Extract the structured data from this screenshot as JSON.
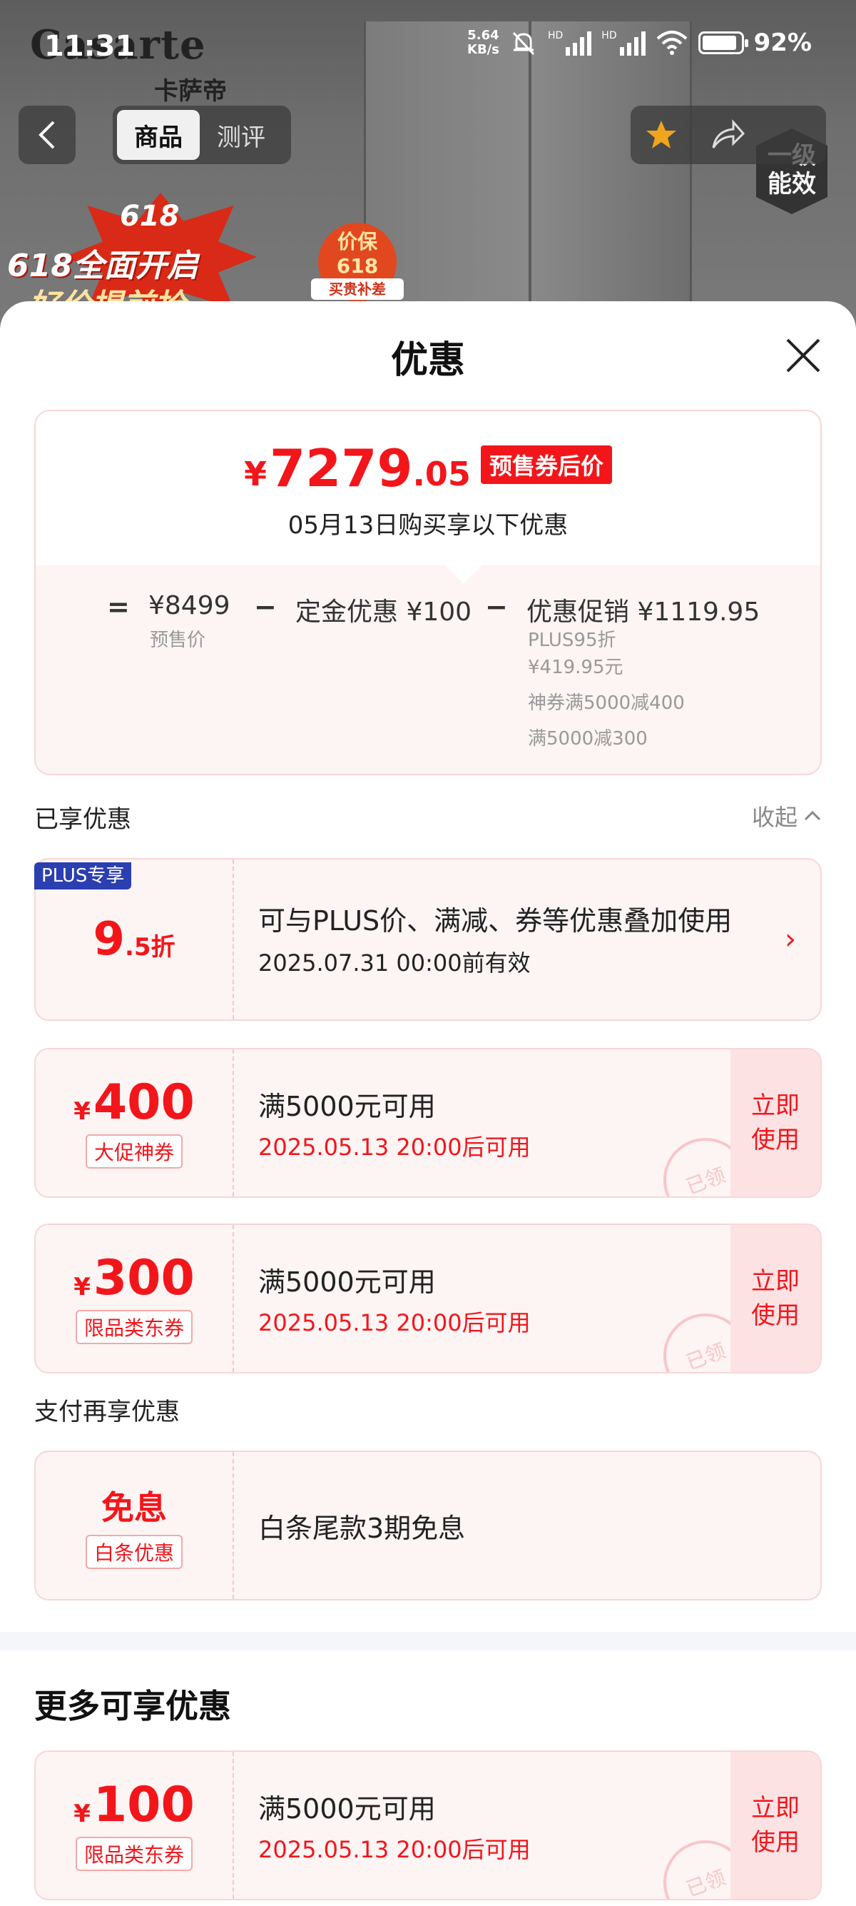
{
  "status_bar": {
    "time": "11:31",
    "speed_value": "5.64",
    "speed_unit": "KB/s",
    "hd1": "HD",
    "hd2": "HD",
    "battery": "92%"
  },
  "header": {
    "brand_en": "Casarte",
    "brand_cn": "卡萨帝",
    "tabs": [
      {
        "label": "商品",
        "active": true
      },
      {
        "label": "测评",
        "active": false
      }
    ],
    "energy_label": "一级能效",
    "promo_618": "618",
    "promo_line1": "618全面开启",
    "promo_line2": "好价提前抢",
    "price_protect": "价保618",
    "price_protect_sub": "买贵补差"
  },
  "sheet": {
    "title": "优惠",
    "summary": {
      "currency": "¥",
      "price_int": "7279",
      "price_dec": ".05",
      "price_tag": "预售券后价",
      "date_line": "05月13日购买享以下优惠",
      "eq": "=",
      "minus": "−",
      "presale_price": "¥8499",
      "presale_label": "预售价",
      "deposit_discount": "定金优惠 ¥100",
      "promo_discount": "优惠促销 ¥1119.95",
      "promo_details": [
        "PLUS95折",
        "¥419.95元",
        "神券满5000减400",
        "满5000减300"
      ]
    },
    "enjoyed": {
      "label": "已享优惠",
      "collapse_label": "收起"
    },
    "plus_card": {
      "badge": "PLUS专享",
      "disc_big": "9",
      "disc_small": ".5折",
      "text": "可与PLUS价、满减、券等优惠叠加使用",
      "valid": "2025.07.31 00:00前有效"
    },
    "coupons": [
      {
        "currency": "¥",
        "amount": "400",
        "tag": "大促神券",
        "condition": "满5000元可用",
        "time": "2025.05.13 20:00后可用",
        "use": "立即使用",
        "stamp": "已领"
      },
      {
        "currency": "¥",
        "amount": "300",
        "tag": "限品类东券",
        "condition": "满5000元可用",
        "time": "2025.05.13 20:00后可用",
        "use": "立即使用",
        "stamp": "已领"
      }
    ],
    "pay": {
      "label": "支付再享优惠",
      "title": "免息",
      "tag": "白条优惠",
      "text": "白条尾款3期免息"
    },
    "more": {
      "title": "更多可享优惠",
      "coupon": {
        "currency": "¥",
        "amount": "100",
        "tag": "限品类东券",
        "condition": "满5000元可用",
        "time": "2025.05.13 20:00后可用",
        "use": "立即使用",
        "stamp": "已领"
      }
    }
  },
  "colors": {
    "accent": "#f2161b",
    "card_bg": "#fdf4f4",
    "card_border": "#f8d6d6",
    "plus_blue": "#2b3fb0"
  }
}
